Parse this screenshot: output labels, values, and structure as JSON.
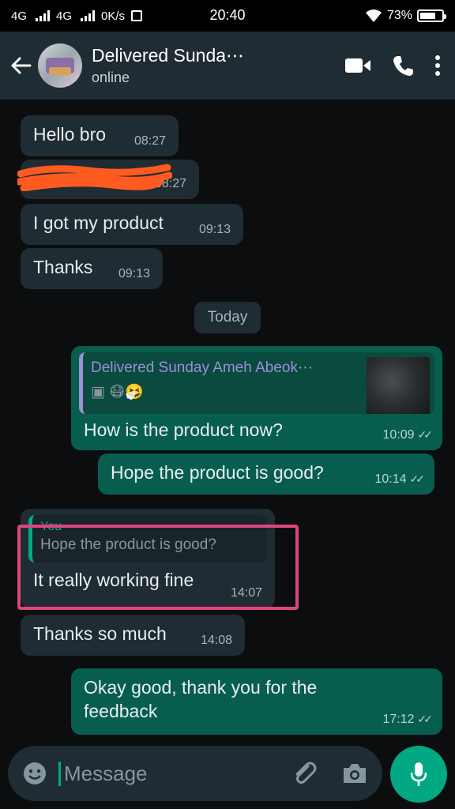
{
  "status_bar": {
    "network1": "4G",
    "network2": "4G",
    "speed": "0K/s",
    "time": "20:40",
    "battery": "73%",
    "battery_level": 0.73
  },
  "header": {
    "contact_name": "Delivered Sunda⋯",
    "status": "online",
    "icons": [
      "back-arrow-icon",
      "video-call-icon",
      "voice-call-icon",
      "more-options-icon"
    ]
  },
  "messages": [
    {
      "dir": "in",
      "text": "Hello bro",
      "time": "08:27"
    },
    {
      "dir": "in",
      "text": "",
      "time": "08:27",
      "redacted": true
    },
    {
      "dir": "in",
      "text": "I got my product",
      "time": "09:13"
    },
    {
      "dir": "in",
      "text": "Thanks",
      "time": "09:13"
    },
    {
      "dir": "out",
      "text": "How is the product now?",
      "time": "10:09",
      "quote": {
        "name": "Delivered Sunday Ameh  Abeok⋯",
        "text": "▣ 😷🤧"
      }
    },
    {
      "dir": "out",
      "text": "Hope the product is good?",
      "time": "10:14"
    },
    {
      "dir": "in",
      "text": "It really working fine",
      "time": "14:07",
      "quote": {
        "name": "You",
        "text": "Hope the product is good?"
      }
    },
    {
      "dir": "in",
      "text": "Thanks so much",
      "time": "14:08"
    },
    {
      "dir": "out",
      "text": "Okay good, thank you for the feedback",
      "time": "17:12"
    }
  ],
  "day_divider": "Today",
  "ticks": "✓✓",
  "input": {
    "placeholder": "Message",
    "icons": [
      "emoji-icon",
      "attach-icon",
      "camera-icon",
      "mic-icon"
    ]
  },
  "colors": {
    "incoming_bubble": "#1f2c33",
    "outgoing_bubble": "#075e4f",
    "accent": "#00a884",
    "highlight_box": "#e0447c",
    "redaction": "#ff5a1f"
  }
}
